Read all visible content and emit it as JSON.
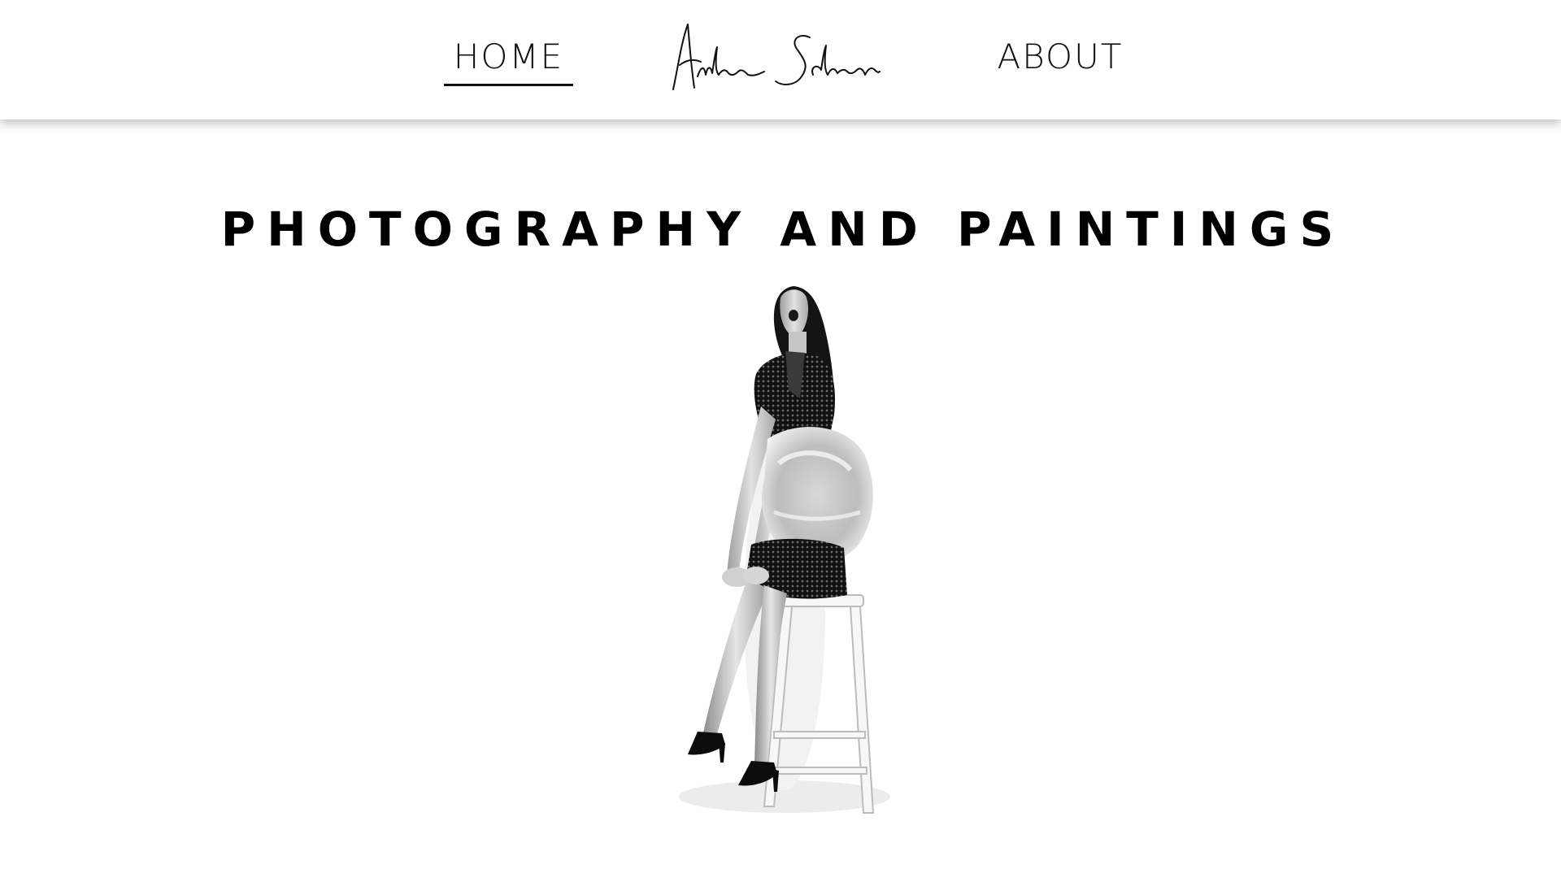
{
  "nav": {
    "home_label": "HOME",
    "about_label": "ABOUT",
    "active_item": "HOME",
    "logo_name": "signature-logo"
  },
  "main": {
    "headline": "PHOTOGRAPHY AND PAINTINGS",
    "hero_image_icon": "seated-woman-photo"
  },
  "colors": {
    "text": "#111111",
    "background": "#ffffff",
    "underline": "#111111"
  }
}
